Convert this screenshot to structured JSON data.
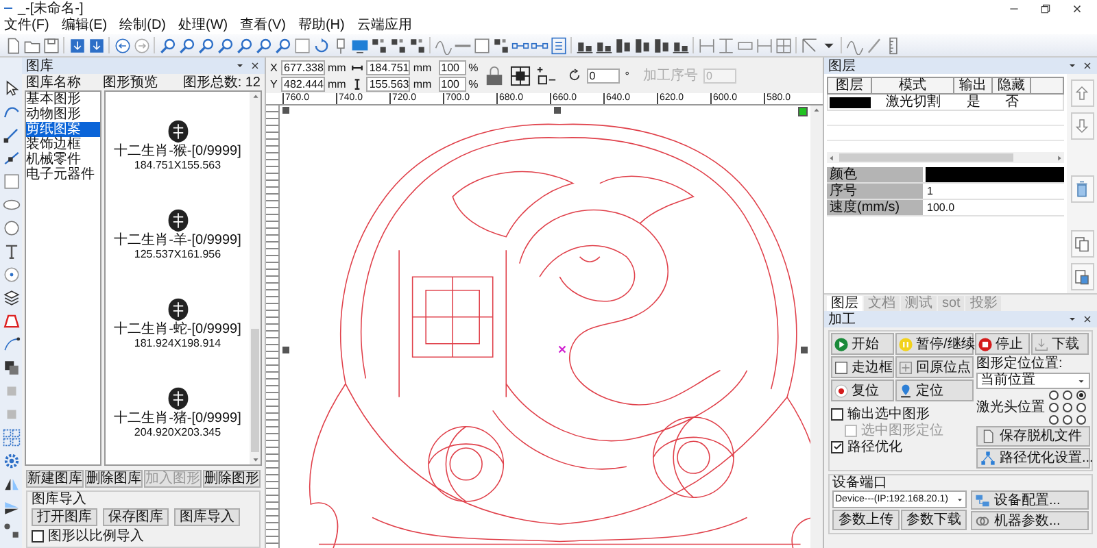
{
  "window": {
    "title": "_-[未命名-]"
  },
  "menu": [
    "文件(F)",
    "编辑(E)",
    "绘制(D)",
    "处理(W)",
    "查看(V)",
    "帮助(H)",
    "云端应用"
  ],
  "library": {
    "title": "图库",
    "col_name": "图库名称",
    "col_preview": "图形预览",
    "count": "图形总数: 12",
    "categories": [
      {
        "label": "基本图形",
        "selected": false
      },
      {
        "label": "动物图形",
        "selected": false
      },
      {
        "label": "剪纸图案",
        "selected": true
      },
      {
        "label": "装饰边框",
        "selected": false
      },
      {
        "label": "机械零件",
        "selected": false
      },
      {
        "label": "电子元器件",
        "selected": false
      }
    ],
    "items": [
      {
        "name": "十二生肖-猴-[0/9999]",
        "size": "184.751X155.563"
      },
      {
        "name": "十二生肖-羊-[0/9999]",
        "size": "125.537X161.956"
      },
      {
        "name": "十二生肖-蛇-[0/9999]",
        "size": "181.924X198.914"
      },
      {
        "name": "十二生肖-猪-[0/9999]",
        "size": "204.920X203.345"
      }
    ],
    "buttons": [
      {
        "label": "新建图库",
        "disabled": false
      },
      {
        "label": "删除图库",
        "disabled": false
      },
      {
        "label": "加入图形",
        "disabled": true
      },
      {
        "label": "删除图形",
        "disabled": false
      }
    ],
    "import_group": {
      "title": "图库导入",
      "buttons": [
        "打开图库",
        "保存图库",
        "图库导入"
      ],
      "checkbox": {
        "label": "图形以比例导入",
        "checked": false
      }
    }
  },
  "position": [
    {
      "label": "X",
      "value": "677.338",
      "unit": "mm"
    },
    {
      "label": "Y",
      "value": "482.444",
      "unit": "mm"
    }
  ],
  "size": [
    {
      "value": "184.751",
      "unit": "mm",
      "scale": "100",
      "scale_unit": "%"
    },
    {
      "value": "155.563",
      "unit": "mm",
      "scale": "100",
      "scale_unit": "%"
    }
  ],
  "rotation": {
    "value": "0",
    "unit": "°"
  },
  "process_order": {
    "label": "加工序号",
    "value": "0",
    "disabled": true
  },
  "ruler": [
    "760.0",
    "740.0",
    "720.0",
    "700.0",
    "680.0",
    "660.0",
    "640.0",
    "620.0",
    "600.0",
    "580.0"
  ],
  "layers": {
    "title": "图层",
    "columns": [
      "图层",
      "模式",
      "输出",
      "隐藏"
    ],
    "rows": [
      {
        "color": "#000000",
        "mode": "激光切割",
        "output": "是",
        "hidden": "否"
      }
    ],
    "properties": [
      {
        "label": "颜色",
        "kind": "color",
        "color": "#000000"
      },
      {
        "label": "序号",
        "kind": "text",
        "value": "1"
      },
      {
        "label": "速度(mm/s)",
        "kind": "text",
        "value": "100.0"
      }
    ]
  },
  "tabs": [
    {
      "label": "图层",
      "selected": true
    },
    {
      "label": "文档",
      "selected": false
    },
    {
      "label": "测试",
      "selected": false
    },
    {
      "label": "sot",
      "selected": false
    },
    {
      "label": "投影",
      "selected": false
    }
  ],
  "process": {
    "title": "加工",
    "controls": [
      {
        "label": "开始",
        "kind": "start"
      },
      {
        "label": "暂停/继续",
        "kind": "pause"
      },
      {
        "label": "停止",
        "kind": "stop"
      },
      {
        "label": "下载",
        "kind": "download"
      }
    ],
    "moves": [
      {
        "label": "走边框",
        "kind": "frame"
      },
      {
        "label": "回原位点",
        "kind": "origin"
      },
      {
        "label": "复位",
        "kind": "reset"
      },
      {
        "label": "定位",
        "kind": "locate"
      }
    ],
    "position_label": "图形定位位置:",
    "position_value": "当前位置",
    "laser_label": "激光头位置",
    "laser_positions": [
      {
        "selected": false
      },
      {
        "selected": false
      },
      {
        "selected": true
      },
      {
        "selected": false
      },
      {
        "selected": false
      },
      {
        "selected": false
      },
      {
        "selected": false
      },
      {
        "selected": false
      },
      {
        "selected": false
      }
    ],
    "options": [
      {
        "label": "输出选中图形",
        "checked": false,
        "disabled": false,
        "children": [
          {
            "label": "选中图形定位",
            "checked": false,
            "disabled": true
          }
        ]
      },
      {
        "label": "路径优化",
        "checked": true,
        "disabled": false
      }
    ],
    "file_buttons": [
      {
        "label": "保存脱机文件",
        "kind": "file"
      },
      {
        "label": "路径优化设置...",
        "kind": "path"
      }
    ],
    "port": {
      "title": "设备端口",
      "device": "Device---(IP:192.168.20.1)",
      "buttons": [
        "参数上传",
        "参数下载"
      ]
    },
    "machine_buttons": [
      {
        "label": "设备配置...",
        "kind": "device"
      },
      {
        "label": "机器参数...",
        "kind": "machine"
      }
    ]
  }
}
